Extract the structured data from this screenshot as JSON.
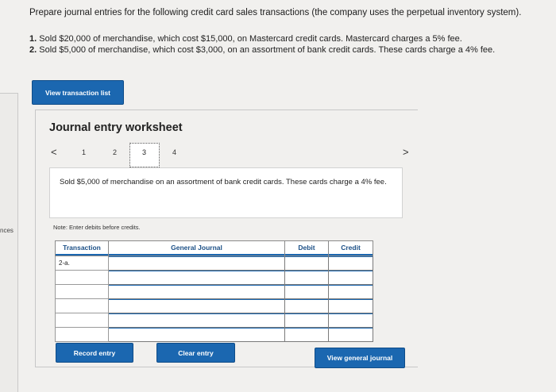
{
  "sidebar": {
    "label": "nces"
  },
  "question": {
    "prompt": "Prepare journal entries for the following credit card sales transactions (the company uses the perpetual inventory system).",
    "items": [
      {
        "num": "1.",
        "text": "Sold $20,000 of merchandise, which cost $15,000, on Mastercard credit cards. Mastercard charges a 5% fee."
      },
      {
        "num": "2.",
        "text": "Sold $5,000 of merchandise, which cost $3,000, on an assortment of bank credit cards. These cards charge a 4% fee."
      }
    ]
  },
  "buttons": {
    "view_transactions": "View transaction list",
    "record": "Record entry",
    "clear": "Clear entry",
    "view_general_journal": "View general journal"
  },
  "worksheet": {
    "title": "Journal entry worksheet",
    "pages": [
      "1",
      "2",
      "3",
      "4"
    ],
    "active_page": "3",
    "prev_icon": "<",
    "next_icon": ">",
    "description": "Sold $5,000 of merchandise on an assortment of bank credit cards. These cards charge a 4% fee.",
    "note": "Note: Enter debits before credits.",
    "columns": [
      "Transaction",
      "General Journal",
      "Debit",
      "Credit"
    ],
    "transaction_label": "2-a."
  }
}
